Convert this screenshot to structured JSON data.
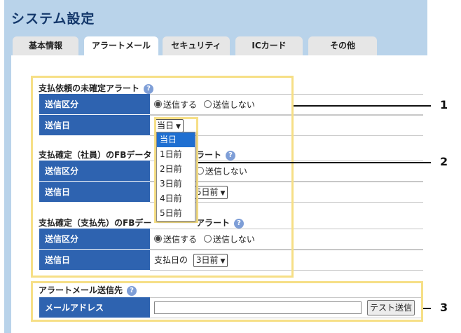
{
  "page": {
    "title": "システム設定"
  },
  "tabs": [
    {
      "label": "基本情報",
      "active": false
    },
    {
      "label": "アラートメール",
      "active": true
    },
    {
      "label": "セキュリティ",
      "active": false
    },
    {
      "label": "ICカード",
      "active": false
    },
    {
      "label": "その他",
      "active": false
    }
  ],
  "help_icon": "question-mark-icon",
  "sections": [
    {
      "title": "支払依頼の未確定アラート",
      "send_label": "送信区分",
      "send_on": "送信する",
      "send_off": "送信しない",
      "send_selected": "送信する",
      "date_label": "送信日",
      "date_value": "当日"
    },
    {
      "title_left": "支払確定（社員）のFBデータ",
      "title_right": "ラート",
      "send_label": "送信区分",
      "send_off": "送信しない",
      "date_label": "送信日",
      "date_value": "5日前"
    },
    {
      "title_left": "支払確定（支払先）のFBデー",
      "title_right": "アラート",
      "send_label": "送信区分",
      "send_on": "送信する",
      "send_off": "送信しない",
      "send_selected": "送信する",
      "date_label": "送信日",
      "date_prefix": "支払日の",
      "date_value": "3日前"
    }
  ],
  "email": {
    "title": "アラートメール送信先",
    "label": "メールアドレス",
    "value": "",
    "test_button": "テスト送信"
  },
  "dropdown": {
    "options": [
      "当日",
      "1日前",
      "2日前",
      "3日前",
      "4日前",
      "5日前"
    ],
    "selected": "当日"
  },
  "callouts": [
    "1",
    "2",
    "3"
  ],
  "colors": {
    "header_bg": "#b9d3ea",
    "title": "#14386b",
    "label_bg": "#2e63b0",
    "callout": "#f6df86",
    "selected_option": "#1f6fd1"
  }
}
